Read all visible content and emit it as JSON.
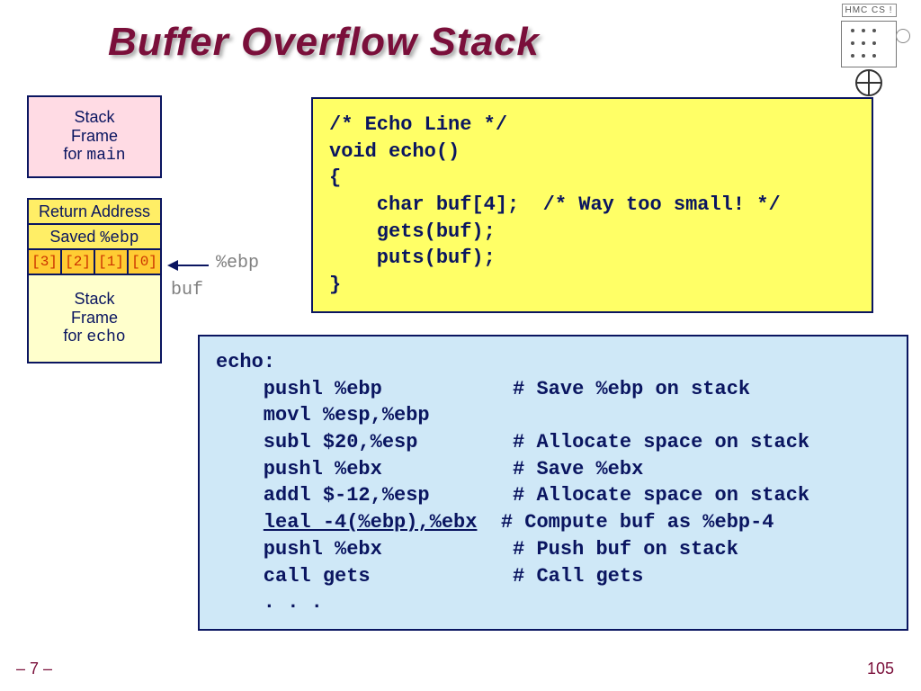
{
  "title": "Buffer Overflow Stack",
  "logo": {
    "banner": "HMC CS !"
  },
  "stack": {
    "main_line1": "Stack",
    "main_line2": "Frame",
    "main_line3_prefix": "for ",
    "main_line3_mono": "main",
    "return_addr": "Return Address",
    "saved_prefix": "Saved ",
    "saved_mono": "%ebp",
    "buf": [
      "[3]",
      "[2]",
      "[1]",
      "[0]"
    ],
    "echo_line1": "Stack",
    "echo_line2": "Frame",
    "echo_line3_prefix": "for ",
    "echo_line3_mono": "echo"
  },
  "labels": {
    "ebp": "%ebp",
    "buf": "buf"
  },
  "code_c": "/* Echo Line */\nvoid echo()\n{\n    char buf[4];  /* Way too small! */\n    gets(buf);\n    puts(buf);\n}",
  "asm": {
    "l0": "echo:",
    "l1": "    pushl %ebp           # Save %ebp on stack",
    "l2": "    movl %esp,%ebp",
    "l3": "    subl $20,%esp        # Allocate space on stack",
    "l4": "    pushl %ebx           # Save %ebx",
    "l5": "    addl $-12,%esp       # Allocate space on stack",
    "l6a": "    ",
    "l6u": "leal -4(%ebp),%ebx",
    "l6b": "  # Compute buf as %ebp-4",
    "l7": "    pushl %ebx           # Push buf on stack",
    "l8": "    call gets            # Call gets",
    "l9": "    . . ."
  },
  "footer": {
    "left": "– 7 –",
    "right": "105"
  }
}
